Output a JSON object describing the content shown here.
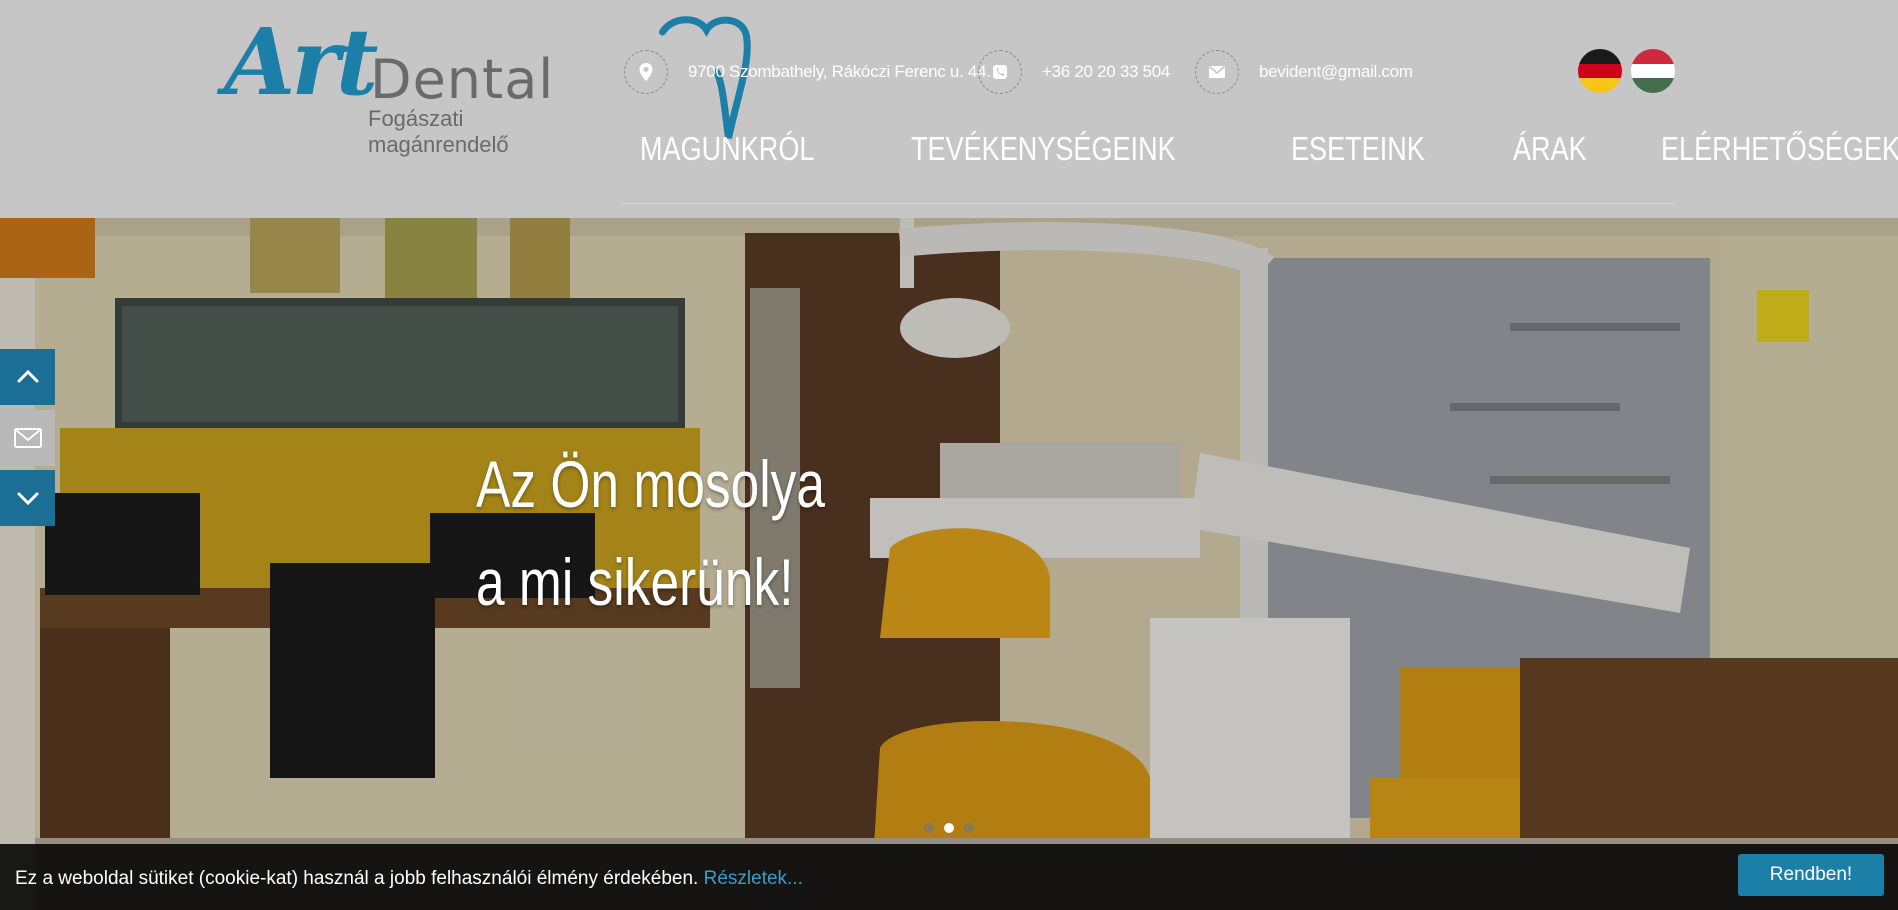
{
  "brand": {
    "logo_art": "Art",
    "logo_dental": "Dental",
    "logo_sub": "Fogászati magánrendelő",
    "primary_color": "#1b7fa8",
    "gray_color": "#6a6a6a"
  },
  "contact": {
    "address": "9700 Szombathely, Rákóczi Ferenc u. 44.",
    "address_icon": "map-pin-icon",
    "phone": "+36 20 20 33 504",
    "phone_icon": "phone-icon",
    "email": "bevident@gmail.com",
    "email_icon": "envelope-icon"
  },
  "languages": [
    {
      "name": "german-flag",
      "colors": [
        "#1a1a1a",
        "#d0021b",
        "#f5c518"
      ]
    },
    {
      "name": "hungarian-flag",
      "colors": [
        "#cd2a3e",
        "#ffffff",
        "#436f4d"
      ]
    }
  ],
  "nav": {
    "items": [
      "MAGUNKRÓL",
      "TEVÉKENYSÉGEINK",
      "ESETEINK",
      "ÁRAK",
      "ELÉRHETŐSÉGEK"
    ]
  },
  "hero": {
    "line1": "Az Ön mosolya",
    "line2": "a mi sikerünk!",
    "slide_count": 3,
    "active_slide": 2
  },
  "side_buttons": [
    {
      "name": "scroll-up-button",
      "icon": "chevron-up-icon",
      "bg": "#1b6f96"
    },
    {
      "name": "contact-mail-button",
      "icon": "envelope-icon",
      "bg": "#b9b9b9"
    },
    {
      "name": "scroll-down-button",
      "icon": "chevron-down-icon",
      "bg": "#1b6f96"
    }
  ],
  "cookie": {
    "text": "Ez a weboldal sütiket (cookie-kat) használ a jobb felhasználói élmény érdekében.",
    "link": "Részletek...",
    "button": "Rendben!"
  }
}
